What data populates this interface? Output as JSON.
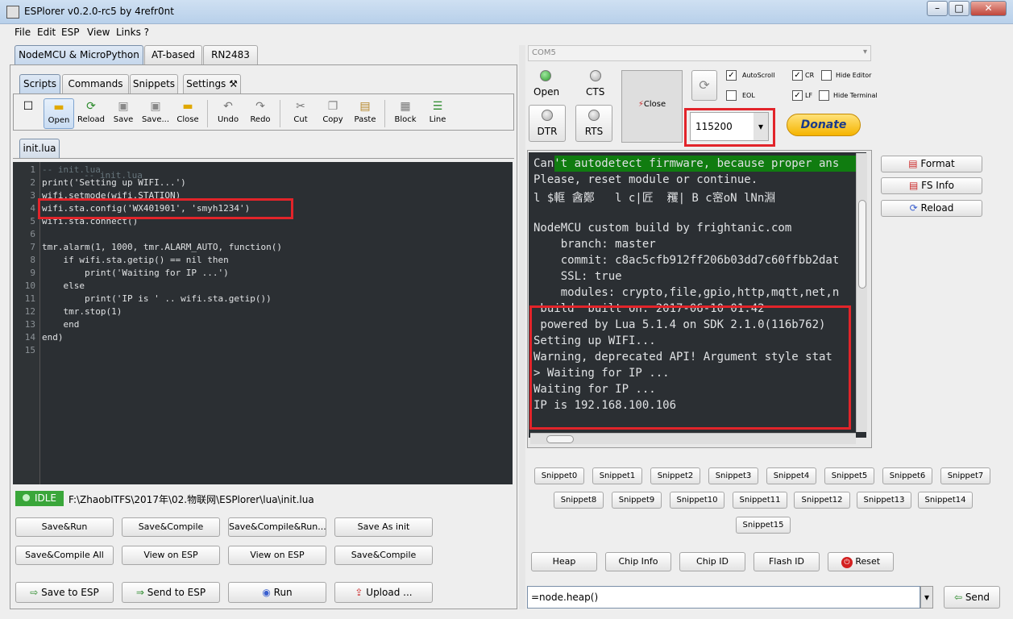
{
  "window": {
    "title": "ESPlorer v0.2.0-rc5 by 4refr0nt"
  },
  "menu": [
    "File",
    "Edit",
    "ESP",
    "View",
    "Links ?"
  ],
  "fw_tabs": [
    "NodeMCU & MicroPython",
    "AT-based",
    "RN2483"
  ],
  "sub_tabs": [
    "Scripts",
    "Commands",
    "Snippets",
    "Settings"
  ],
  "toolbar": {
    "new": "",
    "open": "Open",
    "reload": "Reload",
    "save": "Save",
    "save_as": "Save...",
    "close": "Close",
    "undo": "Undo",
    "redo": "Redo",
    "cut": "Cut",
    "copy": "Copy",
    "paste": "Paste",
    "block": "Block",
    "line": "Line"
  },
  "file_tab": "init.lua",
  "line_numbers": [
    "1",
    "2",
    "3",
    "4",
    "5",
    "6",
    "7",
    "8",
    "9",
    "10",
    "11",
    "12",
    "13",
    "14",
    "15"
  ],
  "code_lines": [
    "-- init.lua",
    "print('Setting up WIFI...')",
    "wifi.setmode(wifi.STATION)",
    "wifi.sta.config('WX401901', 'smyh1234')",
    "wifi.sta.connect()",
    "",
    "tmr.alarm(1, 1000, tmr.ALARM_AUTO, function()",
    "    if wifi.sta.getip() == nil then",
    "        print('Waiting for IP ...')",
    "    else",
    "        print('IP is ' .. wifi.sta.getip())",
    "    tmr.stop(1)",
    "    end",
    "end)",
    ""
  ],
  "status": {
    "state": "IDLE",
    "path": "F:\\ZhaobITFS\\2017年\\02.物联网\\ESPlorer\\lua\\init.lua"
  },
  "actions_row1": [
    "Save&Run",
    "Save&Compile",
    "Save&Compile&Run...",
    "Save As init"
  ],
  "actions_row2": [
    "Save&Compile All",
    "View on ESP",
    "View on ESP",
    "Save&Compile"
  ],
  "actions_row3": [
    "Save to ESP",
    "Send to ESP",
    "Run",
    "Upload ..."
  ],
  "port": {
    "value": "COM5"
  },
  "conn": {
    "open": "Open",
    "cts": "CTS",
    "dtr": "DTR",
    "rts": "RTS",
    "close": "Close"
  },
  "options": {
    "autoscroll": "AutoScroll",
    "cr": "CR",
    "hide_editor": "Hide Editor",
    "eol": "EOL",
    "lf": "LF",
    "hide_terminal": "Hide Terminal"
  },
  "baud": "115200",
  "donate": "Donate",
  "terminal": [
    "Can't autodetect firmware, because proper ans",
    "Please, reset module or continue.",
    "l $軭 酓鄭   l c|匠  矡| B c宻oN lNn淵",
    "",
    "NodeMCU custom build by frightanic.com",
    "    branch: master",
    "    commit: c8ac5cfb912ff206b03dd7c60ffbb2dat",
    "    SSL: true",
    "    modules: crypto,file,gpio,http,mqtt,net,n",
    " build  built on: 2017-06-10 01:42",
    " powered by Lua 5.1.4 on SDK 2.1.0(116b762)",
    "Setting up WIFI...",
    "Warning, deprecated API! Argument style stat",
    "> Waiting for IP ...",
    "Waiting for IP ...",
    "IP is 192.168.100.106"
  ],
  "side_buttons": [
    "Format",
    "FS Info",
    "Reload"
  ],
  "snippets": [
    "Snippet0",
    "Snippet1",
    "Snippet2",
    "Snippet3",
    "Snippet4",
    "Snippet5",
    "Snippet6",
    "Snippet7",
    "Snippet8",
    "Snippet9",
    "Snippet10",
    "Snippet11",
    "Snippet12",
    "Snippet13",
    "Snippet14",
    "Snippet15"
  ],
  "commands": [
    "Heap",
    "Chip Info",
    "Chip ID",
    "Flash ID",
    "Reset"
  ],
  "command_input": "=node.heap()",
  "send": "Send",
  "colors": {
    "accent": "#e2242a",
    "idle": "#3aa63a",
    "donate": "#f5b400"
  }
}
